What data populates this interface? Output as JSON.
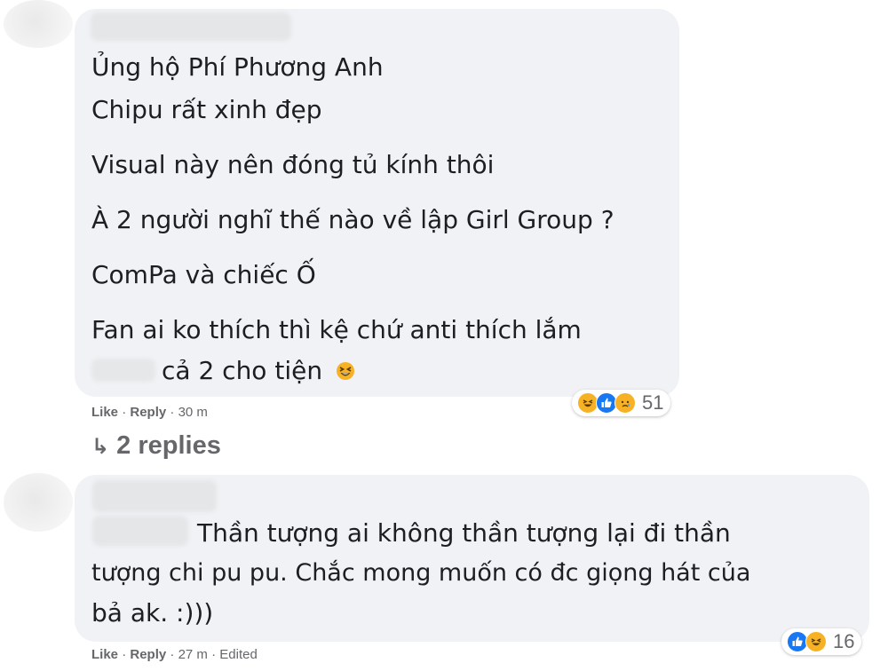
{
  "comments": [
    {
      "lines": [
        "Ủng hộ Phí Phương Anh",
        "Chipu rất xinh đẹp",
        "Visual này nên đóng tủ kính thôi",
        "À 2 người nghĩ thế nào về lập Girl Group ?",
        "ComPa và chiếc Ố",
        "Fan ai ko thích thì kệ chứ anti thích lắm",
        "cả 2 cho tiện"
      ],
      "inline_emoji": "grinning-squinting-face-icon",
      "actions": {
        "like": "Like",
        "reply": "Reply",
        "time": "30 m",
        "separator": "·"
      },
      "reactions": {
        "icons": [
          "haha-icon",
          "like-icon",
          "sad-icon"
        ],
        "count": "51"
      },
      "replies": {
        "label": "2 replies",
        "arrow": "↳"
      }
    },
    {
      "lines": [
        "Thần tượng ai không thần tượng lại đi thần",
        "tượng chi pu pu. Chắc mong muốn có đc giọng hát của",
        "bả ak. :)))"
      ],
      "actions": {
        "like": "Like",
        "reply": "Reply",
        "time": "27 m",
        "edited": "Edited",
        "separator": "·"
      },
      "reactions": {
        "icons": [
          "like-icon",
          "haha-icon"
        ],
        "count": "16"
      }
    }
  ],
  "colors": {
    "bubble": "#f0f2f5",
    "meta": "#65676b",
    "text": "#1c1e21",
    "like_blue": "#1877f2",
    "emoji_yellow": "#f7b125"
  }
}
